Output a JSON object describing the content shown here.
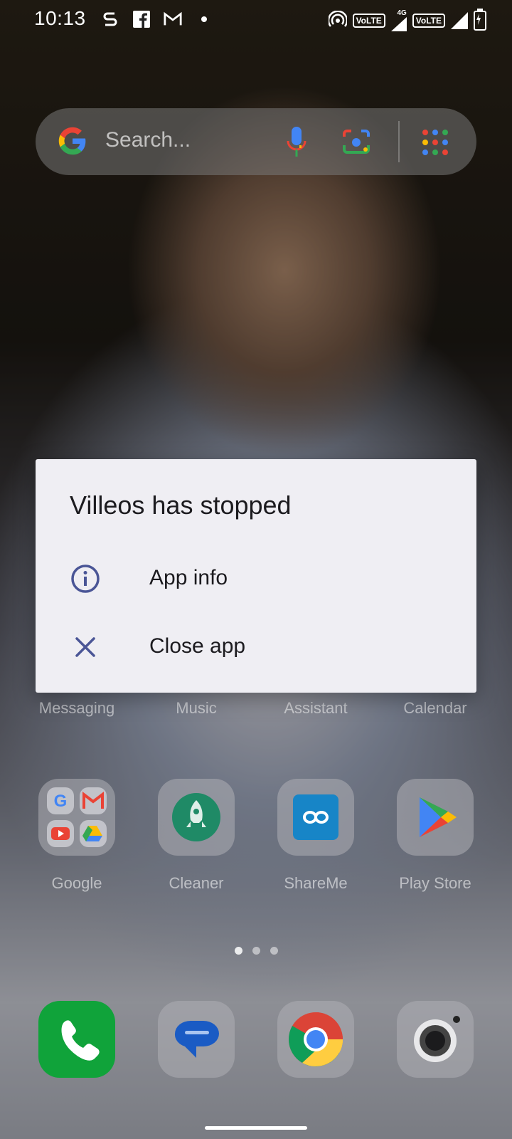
{
  "status_bar": {
    "time": "10:13",
    "left_icons": [
      "notification-s-icon",
      "facebook-icon",
      "gmail-icon",
      "dot-icon"
    ],
    "right_icons": [
      "hotspot-icon",
      "volte-icon",
      "4g-signal-icon",
      "volte-icon",
      "signal-icon",
      "battery-charging-icon"
    ],
    "volte_label": "VoLTE",
    "network_label": "4G"
  },
  "search": {
    "placeholder": "Search..."
  },
  "home": {
    "row1_labels": [
      "Messaging",
      "Music",
      "Assistant",
      "Calendar"
    ],
    "row2": [
      {
        "label": "Google"
      },
      {
        "label": "Cleaner"
      },
      {
        "label": "ShareMe"
      },
      {
        "label": "Play Store"
      }
    ],
    "dock": [
      "phone-icon",
      "messages-icon",
      "chrome-icon",
      "camera-icon"
    ]
  },
  "dialog": {
    "title": "Villeos has stopped",
    "options": [
      {
        "label": "App info",
        "icon": "info-icon"
      },
      {
        "label": "Close app",
        "icon": "close-icon"
      }
    ]
  },
  "colors": {
    "dialog_bg": "#efeef3",
    "dialog_icon": "#4a5596"
  }
}
